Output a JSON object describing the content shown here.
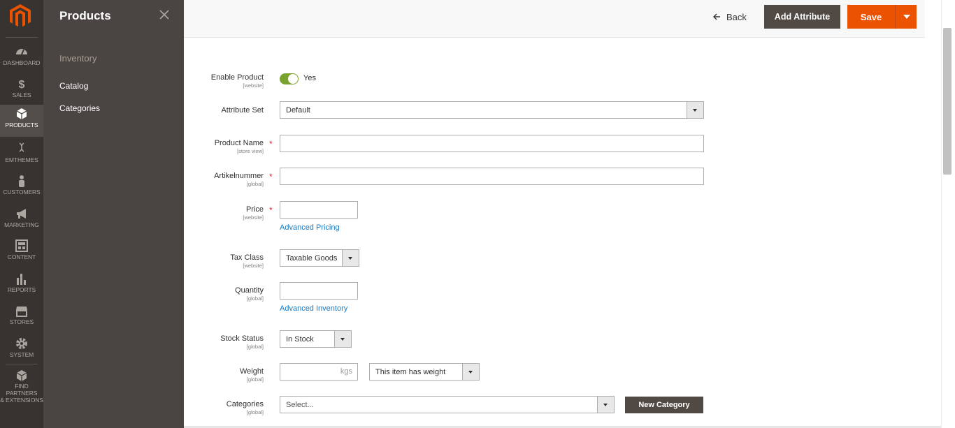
{
  "nav": [
    {
      "label": "DASHBOARD",
      "icon": "dashboard-icon"
    },
    {
      "label": "SALES",
      "icon": "dollar-icon"
    },
    {
      "label": "PRODUCTS",
      "icon": "cube-icon",
      "active": true
    },
    {
      "label": "EMTHEMES",
      "icon": "dna-icon"
    },
    {
      "label": "CUSTOMERS",
      "icon": "person-icon"
    },
    {
      "label": "MARKETING",
      "icon": "megaphone-icon"
    },
    {
      "label": "CONTENT",
      "icon": "layout-icon"
    },
    {
      "label": "REPORTS",
      "icon": "bar-chart-icon"
    },
    {
      "label": "STORES",
      "icon": "store-icon"
    },
    {
      "label": "SYSTEM",
      "icon": "gear-icon"
    },
    {
      "label": "FIND PARTNERS & EXTENSIONS",
      "label1": "FIND PARTNERS",
      "label2": "& EXTENSIONS",
      "icon": "box-icon"
    }
  ],
  "flyout": {
    "title": "Products",
    "group": "Inventory",
    "links": [
      "Catalog",
      "Categories"
    ]
  },
  "actions": {
    "back": "Back",
    "add_attribute": "Add Attribute",
    "save": "Save"
  },
  "form": {
    "enable_product": {
      "label": "Enable Product",
      "scope": "[website]",
      "value": "Yes"
    },
    "attribute_set": {
      "label": "Attribute Set",
      "value": "Default"
    },
    "product_name": {
      "label": "Product Name",
      "scope": "[store view]",
      "value": ""
    },
    "sku": {
      "label": "Artikelnummer",
      "scope": "[global]",
      "value": ""
    },
    "price": {
      "label": "Price",
      "scope": "[website]",
      "value": "",
      "link": "Advanced Pricing"
    },
    "tax_class": {
      "label": "Tax Class",
      "scope": "[website]",
      "value": "Taxable Goods"
    },
    "quantity": {
      "label": "Quantity",
      "scope": "[global]",
      "value": "",
      "link": "Advanced Inventory"
    },
    "stock_status": {
      "label": "Stock Status",
      "scope": "[global]",
      "value": "In Stock"
    },
    "weight": {
      "label": "Weight",
      "scope": "[global]",
      "value": "",
      "unit": "kgs",
      "has_weight": "This item has weight"
    },
    "categories": {
      "label": "Categories",
      "scope": "[global]",
      "placeholder": "Select...",
      "new_button": "New Category"
    }
  },
  "colors": {
    "accent": "#eb5202",
    "nav_bg": "#373330",
    "flyout_bg": "#4a4542",
    "toggle_on": "#79a22e",
    "link": "#1979c3"
  }
}
